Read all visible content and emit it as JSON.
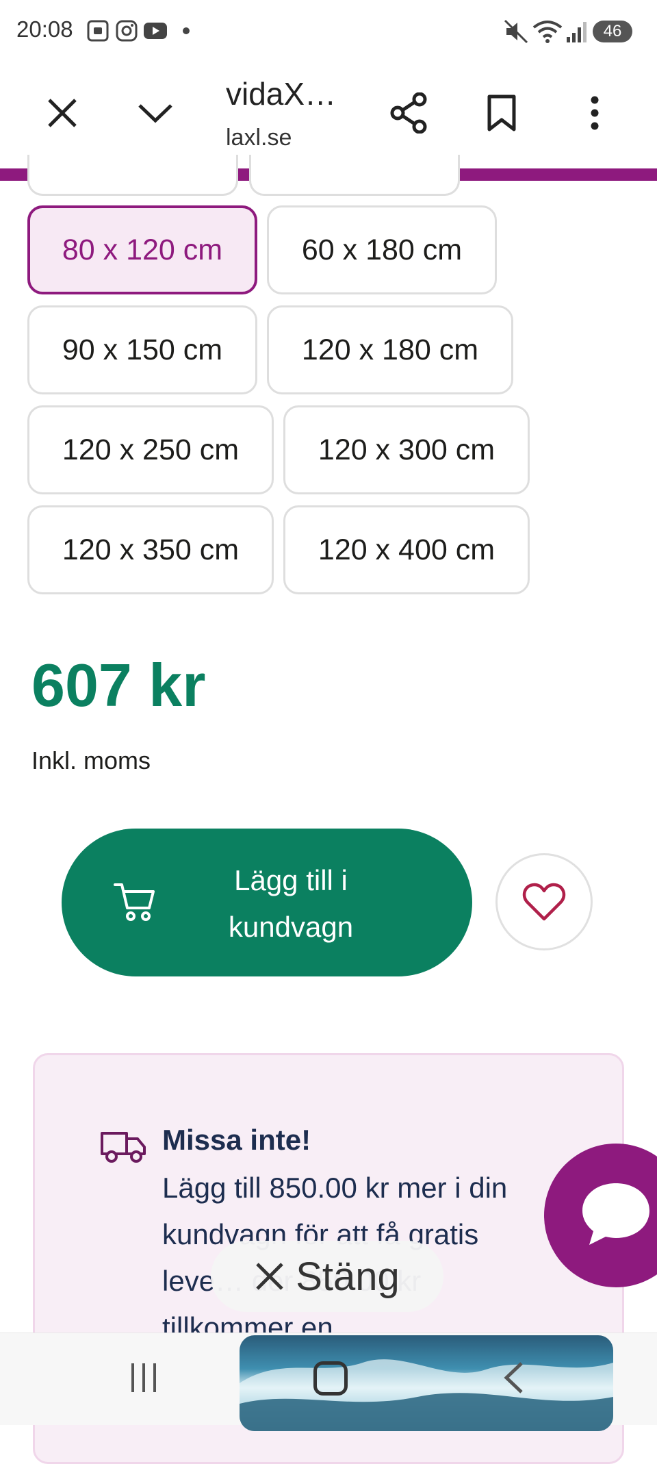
{
  "status_bar": {
    "time": "20:08",
    "battery": "46",
    "icons": [
      "screenshot-icon",
      "instagram-icon",
      "youtube-icon",
      "dot-icon",
      "mute-icon",
      "wifi-icon",
      "signal-icon",
      "battery-icon"
    ]
  },
  "browser": {
    "title": "vidaX…",
    "url": "laxl.se",
    "accent_color": "#8e1a7e"
  },
  "sizes": {
    "options": [
      {
        "label": "80 x 120 cm",
        "selected": true
      },
      {
        "label": "60 x 180 cm",
        "selected": false
      },
      {
        "label": "90 x 150 cm",
        "selected": false
      },
      {
        "label": "120 x 180 cm",
        "selected": false
      },
      {
        "label": "120 x 250 cm",
        "selected": false
      },
      {
        "label": "120 x 300 cm",
        "selected": false
      },
      {
        "label": "120 x 350 cm",
        "selected": false
      },
      {
        "label": "120 x 400 cm",
        "selected": false
      }
    ]
  },
  "product": {
    "price": "607 kr",
    "vat_note": "Inkl. moms",
    "price_color": "#0b8060"
  },
  "actions": {
    "add_to_cart": "Lägg till i kundvagn"
  },
  "promo": {
    "title": "Missa inte!",
    "text": "Lägg till 850.00 kr mer i din kundvagn för att få gratis leve… der 850.00 kr tillkommer en"
  },
  "overlay": {
    "close_label": "Stäng"
  }
}
